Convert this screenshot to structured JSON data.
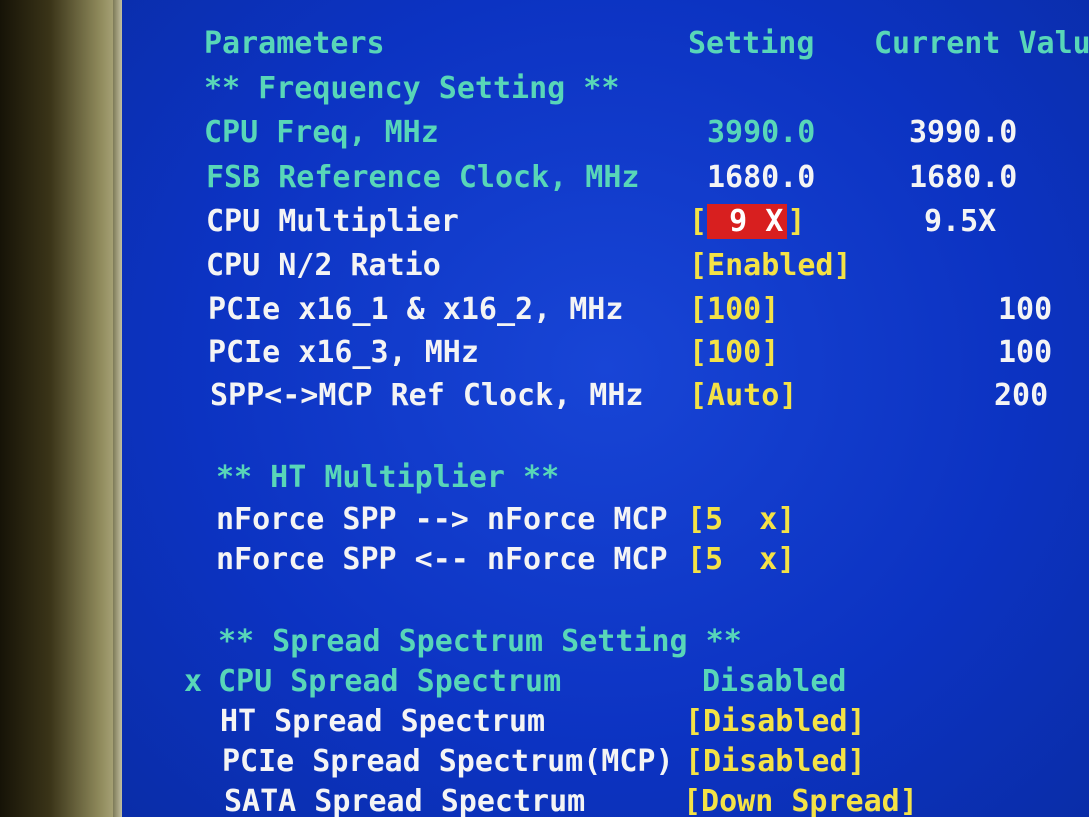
{
  "header": {
    "parameters": "Parameters",
    "setting": "Setting",
    "current_value": "Current Valu"
  },
  "sections": {
    "frequency": "** Frequency Setting **",
    "ht": "** HT Multiplier **",
    "spread": "** Spread Spectrum Setting **"
  },
  "frequency_rows": [
    {
      "label": "CPU Freq, MHz",
      "setting": "3990.0",
      "current": "3990.0"
    },
    {
      "label": "FSB Reference Clock, MHz",
      "setting": "1680.0",
      "current": "1680.0"
    },
    {
      "label": "CPU Multiplier",
      "setting_open": "[",
      "setting_value": " 9 X",
      "setting_close": "]",
      "current": "9.5X"
    },
    {
      "label": "CPU N/2 Ratio",
      "setting": "[Enabled]",
      "current": ""
    },
    {
      "label": "PCIe x16_1 & x16_2, MHz",
      "setting": "[100]",
      "current": "100"
    },
    {
      "label": "PCIe x16_3, MHz",
      "setting": "[100]",
      "current": "100"
    },
    {
      "label": "SPP<->MCP Ref Clock, MHz",
      "setting": "[Auto]",
      "current": "200"
    }
  ],
  "ht_rows": [
    {
      "label": "nForce SPP --> nForce MCP",
      "setting": "[5  x]"
    },
    {
      "label": "nForce SPP <-- nForce MCP",
      "setting": "[5  x]"
    }
  ],
  "spread_rows": [
    {
      "marker": "x",
      "label": "CPU Spread Spectrum",
      "setting": "Disabled"
    },
    {
      "label": "HT Spread Spectrum",
      "setting": "[Disabled]"
    },
    {
      "label": "PCIe Spread Spectrum(MCP)",
      "setting": "[Disabled]"
    },
    {
      "label": "SATA Spread Spectrum",
      "setting": "[Down Spread]"
    }
  ],
  "colors": {
    "screen_bg": "#0d35c6",
    "label_cyan": "#58d6b8",
    "label_white": "#f4f4f4",
    "setting_yellow": "#f4e246",
    "selection_red": "#d81f1f"
  }
}
